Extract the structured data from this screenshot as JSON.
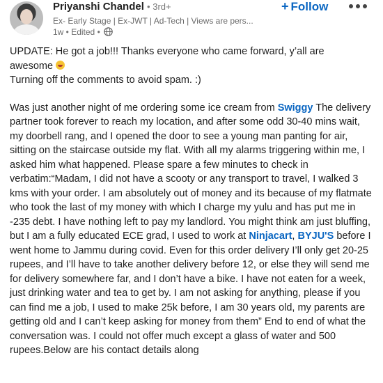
{
  "post": {
    "author": {
      "name": "Priyanshi Chandel",
      "degree": "• 3rd+",
      "headline": "Ex- Early Stage | Ex-JWT | Ad-Tech | Views are pers...",
      "meta": "1w • Edited •"
    },
    "follow_label": "Follow",
    "update_line1": "UPDATE: He got a job!!! Thanks everyone who came forward, y’all are",
    "update_line2": "awesome",
    "update_line3": "Turning off the comments to avoid spam. :)",
    "story_part1": "Was just another night of me ordering some ice cream from ",
    "swiggy": "Swiggy",
    "story_part2": " The delivery partner took forever to reach my location, and after some odd 30-40 mins wait, my doorbell rang, and I opened the door to see a young man panting for air, sitting on the staircase outside my flat. With all my alarms triggering within me, I asked him what happened. Please spare a few minutes to check in verbatim:“Madam, I did not have a scooty or any transport to travel, I walked 3 kms with your order. I am absolutely out of money and its because of my flatmate who took the last of my money with which I charge my yulu and has put me in -235 debt. I have nothing left to pay my landlord. You might think am just bluffing, but I am a fully educated ECE grad, I used to work at ",
    "ninjacart": "Ninjacart",
    "comma": ", ",
    "byjus": "BYJU'S",
    "story_part3": " before I went home to Jammu during covid. Even for this order delivery I’ll only get 20-25 rupees, and I’ll have to take another delivery before 12, or else they will send me for delivery somewhere far, and I don’t have a bike. I have not eaten for a week, just drinking water and tea to get by. I am not asking for anything, please if you can find me a job, I used to make 25k before, I am 30 years old, my parents are getting old and I can’t keep asking for money from them” End to end of what the conversation was. I could not offer much except a glass of water and 500 rupees.Below are his contact details along"
  },
  "icons": [
    "avatar",
    "globe-icon",
    "plus-icon",
    "more-icon",
    "grinning-emoji-icon"
  ],
  "colors": {
    "link": "#0a66c2",
    "text": "#1f1f1f",
    "muted": "#6a6a6a"
  }
}
